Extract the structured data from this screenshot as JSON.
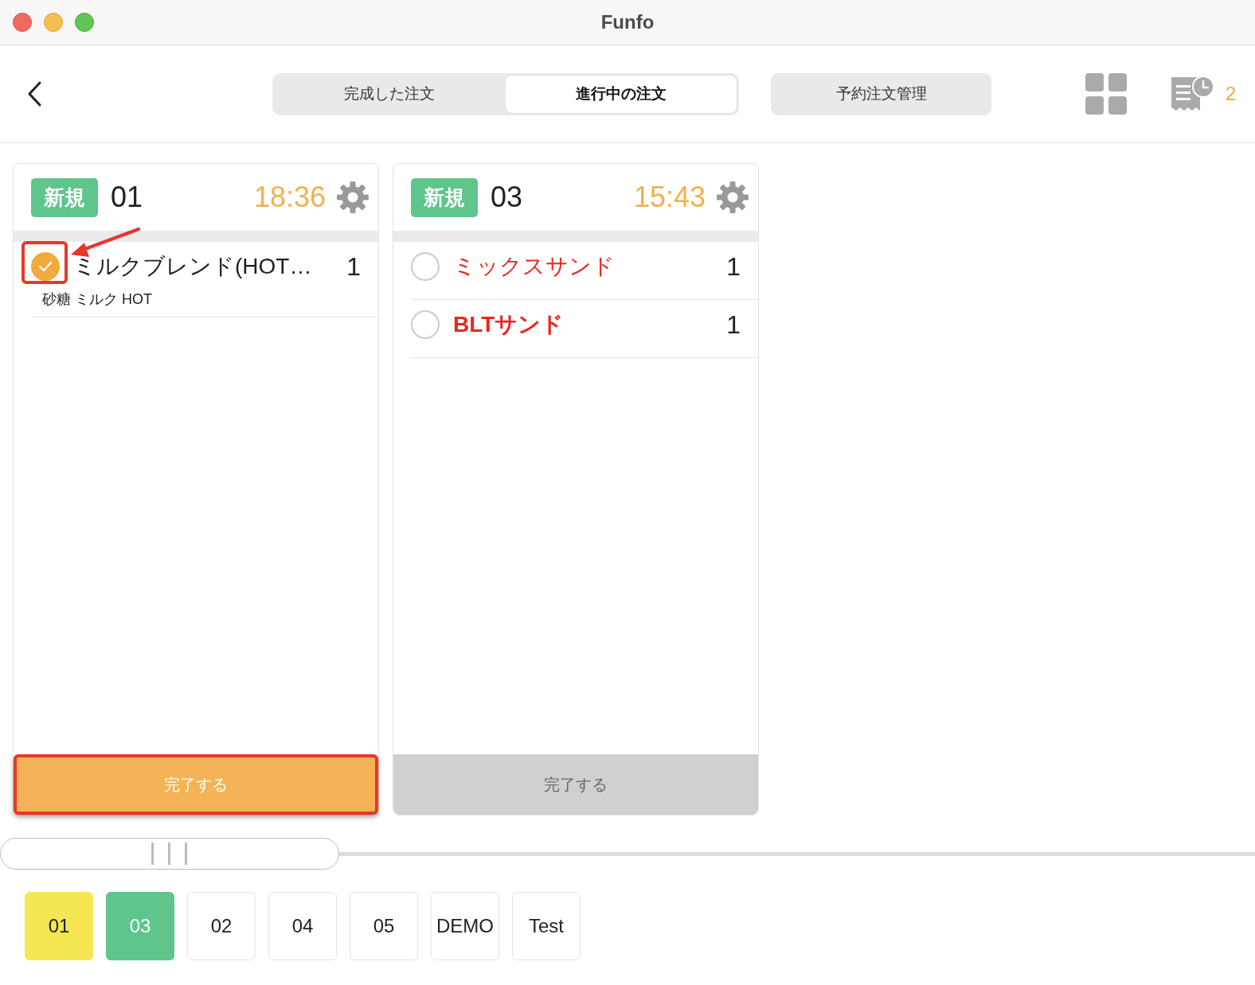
{
  "window": {
    "title": "Funfo"
  },
  "tabs": [
    {
      "label": "完成した注文",
      "selected": false
    },
    {
      "label": "進行中の注文",
      "selected": true
    }
  ],
  "reservation_button": {
    "label": "予約注文管理"
  },
  "receipt_count": "2",
  "orders": [
    {
      "badge": "新規",
      "number": "01",
      "time": "18:36",
      "items": [
        {
          "name": "ミルクブレンド(HOT…",
          "quantity": "1",
          "options": "砂糖 ミルク HOT",
          "checked": true,
          "color": "#1f1f1f",
          "highlighted": true
        }
      ],
      "complete_button": {
        "label": "完了する",
        "disabled": false,
        "highlighted": true
      }
    },
    {
      "badge": "新規",
      "number": "03",
      "time": "15:43",
      "items": [
        {
          "name": "ミックスサンド",
          "quantity": "1",
          "checked": false,
          "color": "#e8281e",
          "highlighted": false
        },
        {
          "name": "BLTサンド",
          "quantity": "1",
          "checked": false,
          "color": "#e8281e",
          "highlighted": false
        }
      ],
      "complete_button": {
        "label": "完了する",
        "disabled": true,
        "highlighted": false
      }
    }
  ],
  "tables": [
    {
      "label": "01",
      "color": "#f5e654"
    },
    {
      "label": "03",
      "color": "#5ec58c"
    },
    {
      "label": "02",
      "color": "#ffffff"
    },
    {
      "label": "04",
      "color": "#ffffff"
    },
    {
      "label": "05",
      "color": "#ffffff"
    },
    {
      "label": "DEMO",
      "color": "#ffffff"
    },
    {
      "label": "Test",
      "color": "#ffffff"
    }
  ]
}
